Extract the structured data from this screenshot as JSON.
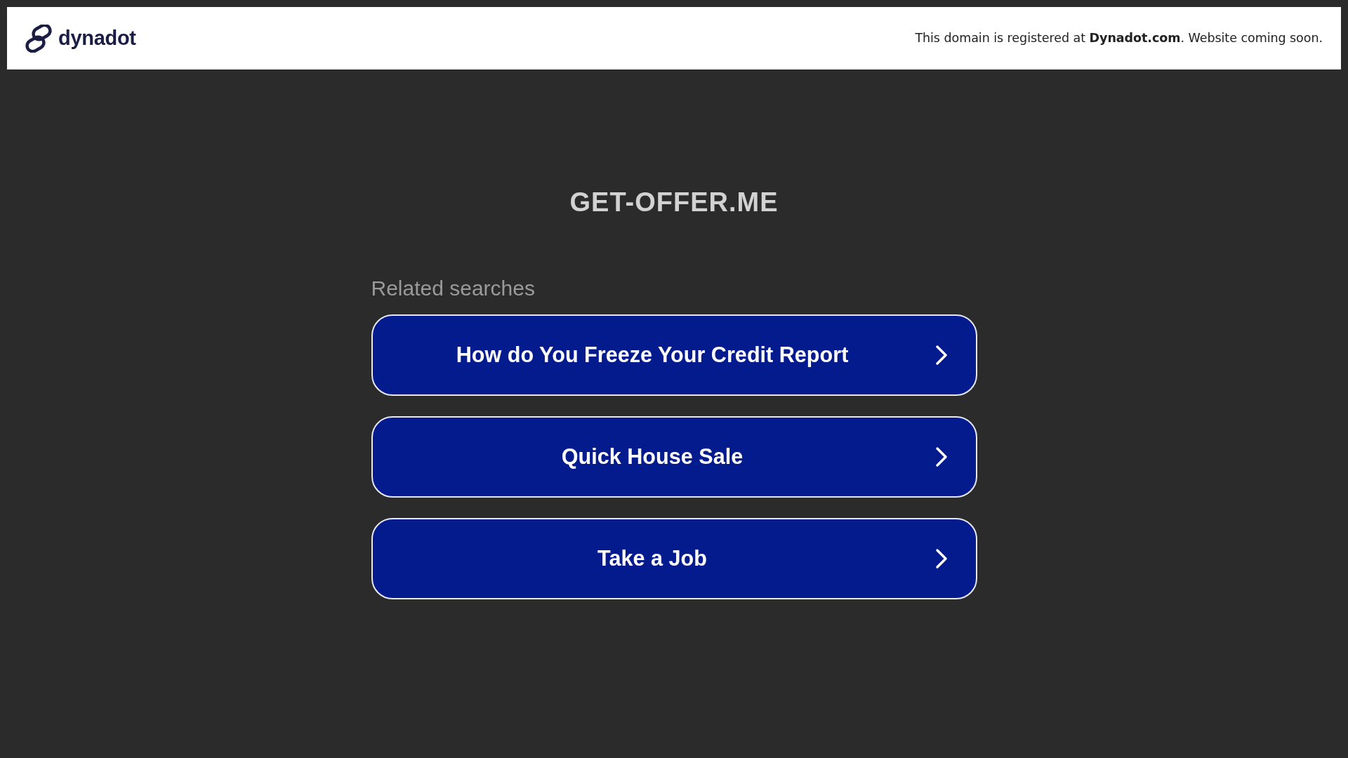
{
  "header": {
    "logo_text": "dynadot",
    "notice": "This domain is registered at **Dynadot.com**. Website coming soon."
  },
  "domain_title": "GET-OFFER.ME",
  "related": {
    "heading": "Related searches",
    "links": [
      {
        "label": "How do You Freeze Your Credit Report"
      },
      {
        "label": "Quick House Sale"
      },
      {
        "label": "Take a Job"
      }
    ]
  }
}
